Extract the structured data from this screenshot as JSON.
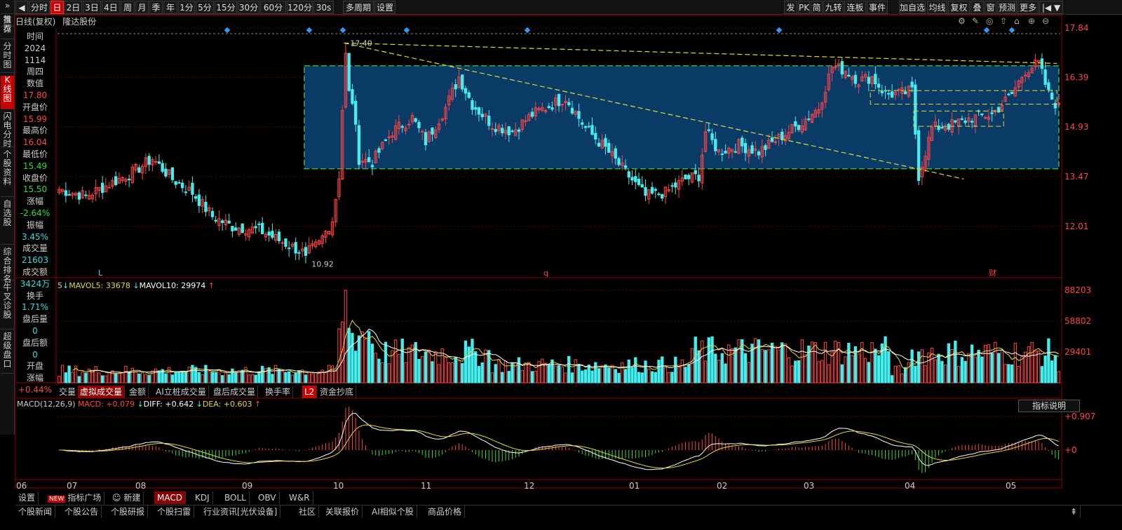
{
  "toolbar": {
    "left": [
      "分时",
      "日",
      "2日",
      "3日",
      "4日",
      "周",
      "月",
      "季",
      "年",
      "1分",
      "5分",
      "15分",
      "30分",
      "60分",
      "120分",
      "30s",
      "多周期",
      "设置"
    ],
    "active": "日",
    "right": [
      "发",
      "PK",
      "简",
      "九转",
      "连板",
      "事件",
      "加自选",
      "均线",
      "复权",
      "叠",
      "窗",
      "预测",
      "更多"
    ]
  },
  "leftnav": [
    "推荐",
    "首页",
    "分时图",
    "K线图",
    "闪电分时",
    "个股资料",
    "自选股",
    "综合排名",
    "牛叉诊股",
    "超级盘口"
  ],
  "leftnav_active": "K线图",
  "header": {
    "title": "日线(复权)",
    "stock": "隆达股份"
  },
  "info": [
    {
      "label": "时间",
      "value": "2024"
    },
    {
      "label": "",
      "value": "1114"
    },
    {
      "label": "周四",
      "value": ""
    },
    {
      "label": "数值",
      "value": "17.80",
      "color": "#ff4444"
    },
    {
      "label": "开盘价",
      "value": "15.99",
      "color": "#ff4444"
    },
    {
      "label": "最高价",
      "value": "16.04",
      "color": "#ff4444"
    },
    {
      "label": "最低价",
      "value": "15.49",
      "color": "#33dd33"
    },
    {
      "label": "收盘价",
      "value": "15.50",
      "color": "#33dd33"
    },
    {
      "label": "涨幅",
      "value": "-2.64%",
      "color": "#33dd33"
    },
    {
      "label": "振幅",
      "value": "3.45%",
      "color": "#33dddd"
    },
    {
      "label": "成交量",
      "value": "21603",
      "color": "#33dddd"
    },
    {
      "label": "成交额",
      "value": "3424万",
      "color": "#33dddd"
    },
    {
      "label": "换手",
      "value": "1.71%",
      "color": "#33dddd"
    },
    {
      "label": "盘后量",
      "value": "0",
      "color": "#33dddd"
    },
    {
      "label": "盘后额",
      "value": "0",
      "color": "#33dddd"
    },
    {
      "label": "开盘",
      "value": ""
    },
    {
      "label": "涨幅",
      "value": "+0.44%",
      "color": "#ff4444"
    }
  ],
  "price_axis": [
    "17.84",
    "16.39",
    "14.93",
    "13.47",
    "12.01"
  ],
  "vol_axis": [
    "88203",
    "58802",
    "29401"
  ],
  "macd_axis": [
    "+0.907",
    "+0"
  ],
  "months": [
    "06",
    "07",
    "08",
    "09",
    "10",
    "11",
    "12",
    "01",
    "02",
    "03",
    "04",
    "05"
  ],
  "annotations": {
    "high": "17.40",
    "low": "10.92",
    "markers": [
      "L",
      "q",
      "财"
    ]
  },
  "vol_legend": {
    "prefix": "5",
    "mavol5_label": "MAVOL5: ",
    "mavol5": "33678",
    "mavol10_label": "MAVOL10: ",
    "mavol10": "29974"
  },
  "subtabs": [
    "交量",
    "虚拟成交量",
    "金额",
    "AI立桩成交量",
    "盘后成交量",
    "换手率",
    "L2",
    "资金抄底"
  ],
  "subtab_active": "虚拟成交量",
  "macd_legend": {
    "name": "MACD(12,26,9)",
    "macd_label": "MACD: ",
    "macd": "+0.079",
    "diff_label": "DIFF: ",
    "diff": "+0.642",
    "dea_label": "DEA: ",
    "dea": "+0.603"
  },
  "macd_button": "指标说明",
  "bottom_tabs": [
    "设置",
    "指标广场",
    "新建",
    "MACD",
    "KDJ",
    "BOLL",
    "OBV",
    "W&R"
  ],
  "bottom_new_badge": "NEW",
  "bottom_active": "MACD",
  "bottom_links": [
    "个股新闻",
    "个股公告",
    "个股研报",
    "个股扫雷",
    "行业资讯[光伏设备]",
    "社区",
    "关联报价",
    "AI相似个股",
    "商品价格"
  ],
  "colors": {
    "up": "#ff4444",
    "down": "#44eeee",
    "ma5": "#ffffff",
    "ma10": "#e6d83a",
    "box": "#0a3a66",
    "boxline": "#44dd44",
    "dash": "#dddd33"
  },
  "chart_data": {
    "type": "candlestick",
    "ylim": [
      10.5,
      17.84
    ],
    "x_months": [
      "06",
      "07",
      "08",
      "09",
      "10",
      "11",
      "12",
      "01",
      "02",
      "03",
      "04",
      "05"
    ],
    "highlights": {
      "high": 17.4,
      "low": 10.92
    },
    "box": {
      "top": 16.73,
      "bottom": 13.7
    },
    "anchors": [
      {
        "i": 0,
        "c": 13.1
      },
      {
        "i": 8,
        "c": 12.9
      },
      {
        "i": 14,
        "c": 13.2
      },
      {
        "i": 22,
        "c": 13.6
      },
      {
        "i": 28,
        "c": 14.0
      },
      {
        "i": 34,
        "c": 13.4
      },
      {
        "i": 40,
        "c": 13.0
      },
      {
        "i": 46,
        "c": 12.3
      },
      {
        "i": 52,
        "c": 12.0
      },
      {
        "i": 60,
        "c": 11.9
      },
      {
        "i": 68,
        "c": 11.5
      },
      {
        "i": 74,
        "c": 11.2
      },
      {
        "i": 78,
        "c": 11.5
      },
      {
        "i": 82,
        "c": 12.2
      },
      {
        "i": 84,
        "c": 13.5
      },
      {
        "i": 86,
        "c": 17.4
      },
      {
        "i": 90,
        "c": 14.0
      },
      {
        "i": 94,
        "c": 13.9
      },
      {
        "i": 100,
        "c": 14.8
      },
      {
        "i": 106,
        "c": 15.2
      },
      {
        "i": 110,
        "c": 14.5
      },
      {
        "i": 116,
        "c": 15.5
      },
      {
        "i": 120,
        "c": 16.4
      },
      {
        "i": 124,
        "c": 15.6
      },
      {
        "i": 130,
        "c": 15.0
      },
      {
        "i": 136,
        "c": 14.8
      },
      {
        "i": 142,
        "c": 15.3
      },
      {
        "i": 148,
        "c": 15.6
      },
      {
        "i": 152,
        "c": 15.8
      },
      {
        "i": 158,
        "c": 14.9
      },
      {
        "i": 164,
        "c": 14.3
      },
      {
        "i": 170,
        "c": 13.6
      },
      {
        "i": 176,
        "c": 12.9
      },
      {
        "i": 182,
        "c": 13.0
      },
      {
        "i": 188,
        "c": 13.4
      },
      {
        "i": 192,
        "c": 13.5
      },
      {
        "i": 194,
        "c": 14.8
      },
      {
        "i": 198,
        "c": 14.2
      },
      {
        "i": 204,
        "c": 14.4
      },
      {
        "i": 210,
        "c": 14.2
      },
      {
        "i": 216,
        "c": 14.6
      },
      {
        "i": 222,
        "c": 15.0
      },
      {
        "i": 228,
        "c": 15.5
      },
      {
        "i": 232,
        "c": 16.7
      },
      {
        "i": 236,
        "c": 16.6
      },
      {
        "i": 240,
        "c": 16.3
      },
      {
        "i": 244,
        "c": 16.4
      },
      {
        "i": 248,
        "c": 15.9
      },
      {
        "i": 252,
        "c": 15.9
      },
      {
        "i": 256,
        "c": 16.0
      },
      {
        "i": 258,
        "c": 13.5
      },
      {
        "i": 262,
        "c": 14.9
      },
      {
        "i": 268,
        "c": 15.0
      },
      {
        "i": 274,
        "c": 15.2
      },
      {
        "i": 280,
        "c": 15.3
      },
      {
        "i": 286,
        "c": 15.9
      },
      {
        "i": 290,
        "c": 16.6
      },
      {
        "i": 294,
        "c": 16.8
      },
      {
        "i": 297,
        "c": 15.9
      },
      {
        "i": 300,
        "c": 15.5
      }
    ],
    "volume": {
      "max": 88203,
      "mavol5": 33678,
      "mavol10": 29974
    },
    "macd": {
      "diff": 0.642,
      "dea": 0.603,
      "macd": 0.079,
      "ymax": 0.907
    }
  }
}
